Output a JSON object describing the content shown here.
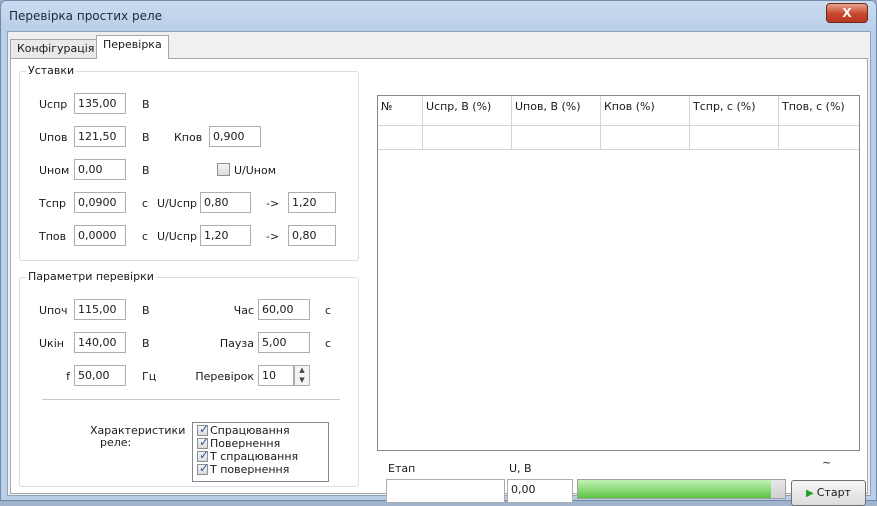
{
  "window": {
    "title": "Перевірка простих реле",
    "close_label": "X"
  },
  "tabs": [
    {
      "label": "Конфігурація"
    },
    {
      "label": "Перевірка"
    }
  ],
  "setpoints": {
    "title": "Уставки",
    "u_pickup": {
      "label": "Uспр",
      "value": "135,00",
      "unit": "В"
    },
    "u_dropout": {
      "label": "Uпов",
      "value": "121,50",
      "unit": "В"
    },
    "k_return": {
      "label": "Кпов",
      "value": "0,900"
    },
    "u_nominal": {
      "label": "Uном",
      "value": "0,00",
      "unit": "В"
    },
    "u_unom_checkbox": {
      "label": "U/Uном",
      "checked": false
    },
    "t_pickup": {
      "label": "Tспр",
      "value": "0,0900",
      "unit": "с",
      "ratio_label": "U/Uспр",
      "from": "0,80",
      "arrow": "->",
      "to": "1,20"
    },
    "t_dropout": {
      "label": "Tпов",
      "value": "0,0000",
      "unit": "с",
      "ratio_label": "U/Uспр",
      "from": "1,20",
      "arrow": "->",
      "to": "0,80"
    }
  },
  "test_params": {
    "title": "Параметри перевірки",
    "u_start": {
      "label": "Uпоч",
      "value": "115,00",
      "unit": "В"
    },
    "u_end": {
      "label": "Uкін",
      "value": "140,00",
      "unit": "В"
    },
    "freq": {
      "label": "f",
      "value": "50,00",
      "unit": "Гц"
    },
    "time": {
      "label": "Час",
      "value": "60,00",
      "unit": "с"
    },
    "pause": {
      "label": "Пауза",
      "value": "5,00",
      "unit": "с"
    },
    "checks": {
      "label": "Перевірок",
      "value": "10"
    },
    "characteristics_label_1": "Характеристики",
    "characteristics_label_2": "реле:",
    "characteristics": [
      {
        "label": "Спрацювання",
        "checked": true
      },
      {
        "label": "Повернення",
        "checked": true
      },
      {
        "label": "Т спрацювання",
        "checked": true
      },
      {
        "label": "Т повернення",
        "checked": true
      }
    ]
  },
  "results_table": {
    "columns": [
      "№",
      "Uспр, В (%)",
      "Uпов, В (%)",
      "Кпов (%)",
      "Tспр, с (%)",
      "Tпов, с (%)"
    ],
    "rows": [
      [
        "",
        "",
        "",
        "",
        "",
        ""
      ]
    ]
  },
  "status": {
    "stage_label": "Етап",
    "stage_value": "",
    "u_label": "U, В",
    "u_value": "0,00",
    "tilde": "~",
    "progress": 0.93,
    "start_label": "Старт"
  },
  "colors": {
    "progress_fill": "#5cc542",
    "close_button": "#c7462c",
    "start_icon": "#21a121"
  }
}
